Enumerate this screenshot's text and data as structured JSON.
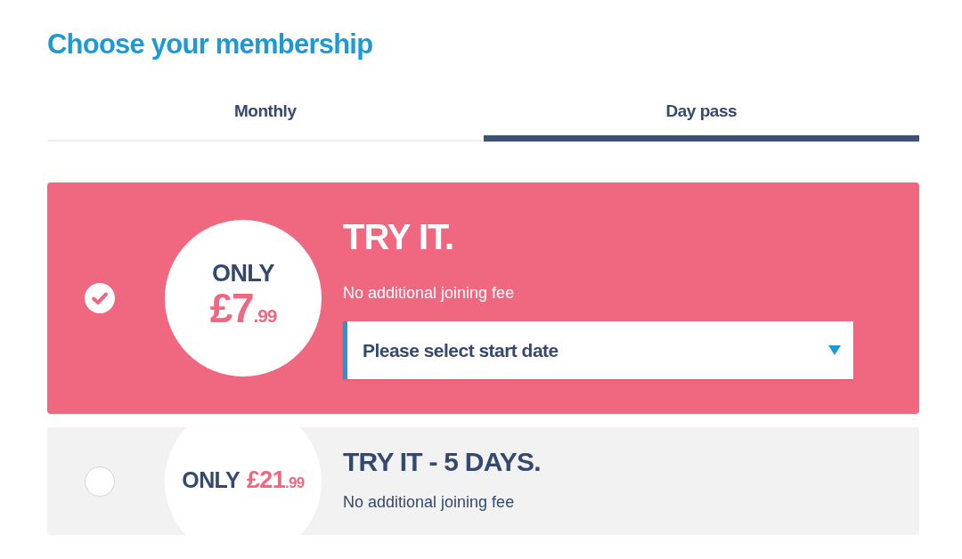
{
  "title": "Choose your membership",
  "tabs": [
    {
      "label": "Monthly",
      "selected": false
    },
    {
      "label": "Day pass",
      "selected": true
    }
  ],
  "plans": [
    {
      "selected": true,
      "price_prefix": "ONLY",
      "price_whole": "£7",
      "price_pence": ".99",
      "name": "TRY IT.",
      "note": "No additional joining fee",
      "start_date": {
        "placeholder": "Please select start date"
      }
    },
    {
      "selected": false,
      "price_prefix": "ONLY",
      "price_whole": "£21",
      "price_pence": ".99",
      "name": "TRY IT - 5 DAYS.",
      "note": "No additional joining fee"
    }
  ]
}
